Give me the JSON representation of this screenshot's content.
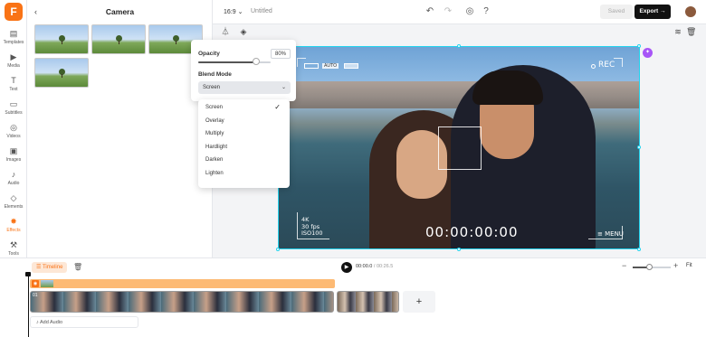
{
  "app": {
    "logo_letter": "F",
    "accent_color": "#f97316"
  },
  "sidebar": {
    "items": [
      {
        "label": "Templates",
        "icon": "templates-icon"
      },
      {
        "label": "Media",
        "icon": "media-icon"
      },
      {
        "label": "Text",
        "icon": "text-icon"
      },
      {
        "label": "Subtitles",
        "icon": "subtitles-icon"
      },
      {
        "label": "Videos",
        "icon": "videos-icon"
      },
      {
        "label": "Images",
        "icon": "images-icon"
      },
      {
        "label": "Audio",
        "icon": "audio-icon"
      },
      {
        "label": "Elements",
        "icon": "elements-icon"
      },
      {
        "label": "Effects",
        "icon": "effects-icon",
        "active": true
      },
      {
        "label": "Tools",
        "icon": "tools-icon"
      }
    ]
  },
  "panel": {
    "title": "Camera",
    "back_icon": "chevron-left-icon",
    "thumbnail_count": 4
  },
  "header": {
    "aspect_ratio": "16:9",
    "project_title": "Untitled",
    "saved_label": "Saved",
    "export_label": "Export"
  },
  "popover": {
    "opacity_label": "Opacity",
    "opacity_value": "80%",
    "opacity_fraction": 0.8,
    "blend_mode_label": "Blend Mode",
    "blend_mode_selected": "Screen"
  },
  "blend_modes": [
    {
      "label": "Screen",
      "selected": true
    },
    {
      "label": "Overlay",
      "selected": false
    },
    {
      "label": "Multiply",
      "selected": false
    },
    {
      "label": "Hardlight",
      "selected": false
    },
    {
      "label": "Darken",
      "selected": false
    },
    {
      "label": "Lighten",
      "selected": false
    }
  ],
  "canvas_overlay": {
    "rec_label": "REC",
    "auto_label": "AUTO",
    "spec_resolution": "4K",
    "spec_fps": "30 fps",
    "spec_iso": "ISO100",
    "timecode": "00:00:00:00",
    "menu_label": "MENU"
  },
  "timeline": {
    "tab_label": "Timeline",
    "current_time": "00:00.0",
    "total_time": "/ 00:26.5",
    "zoom_fraction": 0.45,
    "fit_label": "Fit",
    "clip_number": "01",
    "add_clip_label": "+",
    "add_audio_label": "Add Audio"
  }
}
